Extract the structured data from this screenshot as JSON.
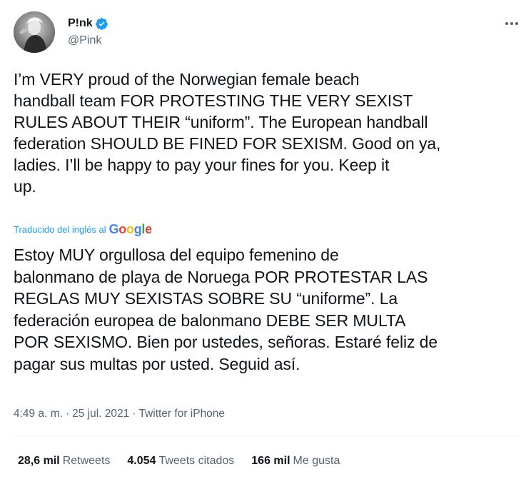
{
  "author": {
    "display_name": "P!nk",
    "handle": "@Pink"
  },
  "tweet": {
    "text": "I’m VERY proud of the Norwegian female beach\nhandball team FOR PROTESTING THE VERY SEXIST\nRULES ABOUT THEIR “uniform”. The European handball\nfederation SHOULD BE FINED FOR SEXISM. Good on ya,\nladies. I’ll be happy to pay your fines for you. Keep it\nup.",
    "translated_label": "Traducido del inglés al",
    "translated_provider": "Google",
    "translation": "Estoy MUY orgullosa del equipo femenino de\nbalonmano de playa de Noruega POR PROTESTAR LAS\nREGLAS MUY SEXISTAS SOBRE SU “uniforme”. La\nfederación europea de balonmano DEBE SER MULTA\nPOR SEXISMO. Bien por ustedes, señoras. Estaré feliz de\npagar sus multas por usted. Seguid así.",
    "time": "4:49 a. m.",
    "separator": "·",
    "date": "25 jul. 2021",
    "source": "Twitter for iPhone"
  },
  "stats": {
    "retweets_count": "28,6 mil",
    "retweets_label": "Retweets",
    "quotes_count": "4.054",
    "quotes_label": "Tweets citados",
    "likes_count": "166 mil",
    "likes_label": "Me gusta"
  },
  "icons": {
    "verified": "verified-badge-icon",
    "more": "more-options-icon"
  },
  "colors": {
    "text": "#0f1419",
    "secondary": "#536471",
    "accent": "#1d9bf0",
    "divider": "#eff3f4"
  }
}
